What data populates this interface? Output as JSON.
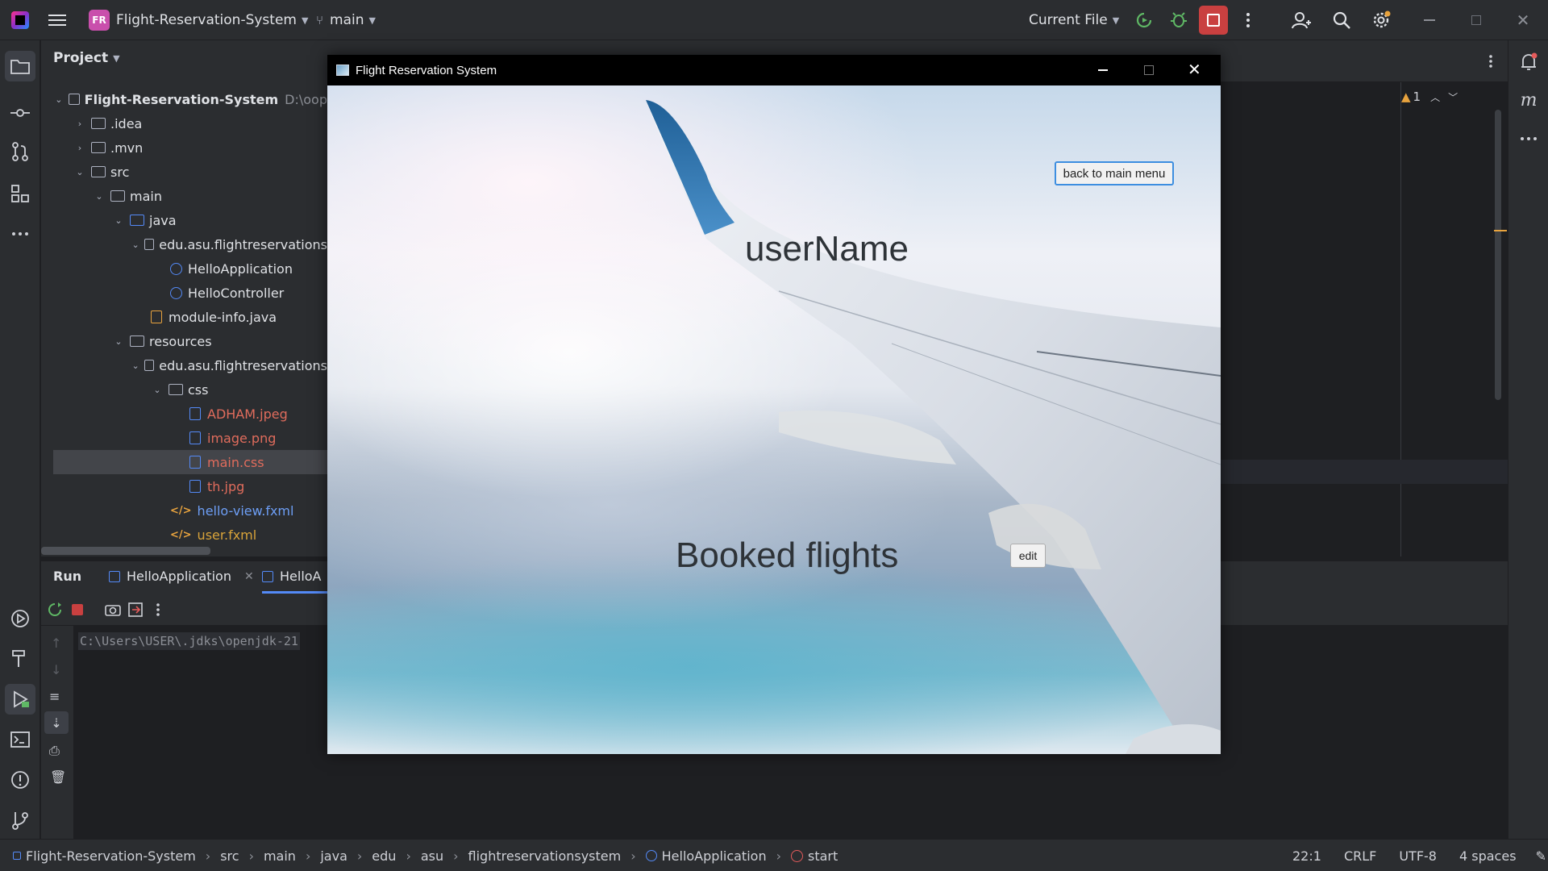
{
  "ide": {
    "project_badge": "FR",
    "project_name": "Flight-Reservation-System",
    "branch": "main",
    "run_config": "Current File"
  },
  "project_panel": {
    "title": "Project",
    "tree": [
      {
        "label": "Flight-Reservation-System",
        "suffix": "D:\\oop"
      },
      {
        "label": ".idea"
      },
      {
        "label": ".mvn"
      },
      {
        "label": "src"
      },
      {
        "label": "main"
      },
      {
        "label": "java"
      },
      {
        "label": "edu.asu.flightreservations"
      },
      {
        "label": "HelloApplication"
      },
      {
        "label": "HelloController"
      },
      {
        "label": "module-info.java"
      },
      {
        "label": "resources"
      },
      {
        "label": "edu.asu.flightreservations"
      },
      {
        "label": "css"
      },
      {
        "label": "ADHAM.jpeg"
      },
      {
        "label": "image.png"
      },
      {
        "label": "main.css"
      },
      {
        "label": "th.jpg"
      },
      {
        "label": "hello-view.fxml"
      },
      {
        "label": "user.fxml"
      }
    ]
  },
  "editor": {
    "warning_count": "1"
  },
  "run_panel": {
    "title": "Run",
    "tabs": [
      "HelloApplication",
      "HelloA"
    ],
    "console_line": "C:\\Users\\USER\\.jdks\\openjdk-21"
  },
  "statusbar": {
    "breadcrumbs": [
      "Flight-Reservation-System",
      "src",
      "main",
      "java",
      "edu",
      "asu",
      "flightreservationsystem",
      "HelloApplication",
      "start"
    ],
    "position": "22:1",
    "line_sep": "CRLF",
    "encoding": "UTF-8",
    "indent": "4 spaces"
  },
  "app_window": {
    "title": "Flight Reservation System",
    "back_button": "back to main menu",
    "username": "userName",
    "booked_label": "Booked flights",
    "edit_button": "edit"
  }
}
